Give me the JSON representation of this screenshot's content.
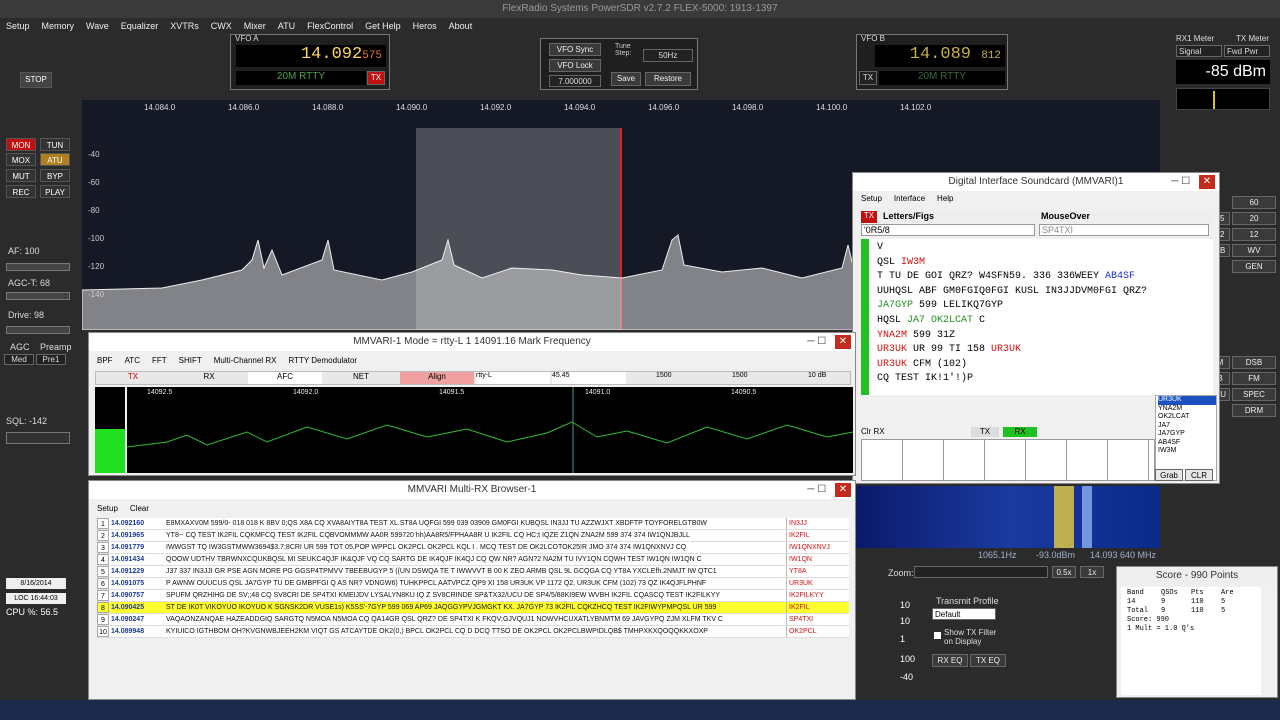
{
  "app": {
    "title": "FlexRadio Systems    PowerSDR    v2.7.2    FLEX-5000: 1913-1397"
  },
  "menu": [
    "Setup",
    "Memory",
    "Wave",
    "Equalizer",
    "XVTRs",
    "CWX",
    "Mixer",
    "ATU",
    "FlexControl",
    "Get Help",
    "Heros",
    "About"
  ],
  "vfoA": {
    "label": "VFO A",
    "freq": "14.092",
    "freq_small": "575",
    "mode": "20M RTTY",
    "tx": "TX"
  },
  "vfoB": {
    "label": "VFO B",
    "freq": "14.089",
    "freq_small": "812",
    "mode": "20M RTTY",
    "tx": "TX"
  },
  "center": {
    "sync": "VFO Sync",
    "lock": "VFO Lock",
    "tune_step_label": "Tune Step:",
    "tune_step": "50Hz",
    "freq": "7.000000",
    "save": "Save",
    "restore": "Restore"
  },
  "meter": {
    "rx1_label": "RX1 Meter",
    "tx_label": "TX Meter",
    "rx_sel": "Signal",
    "tx_sel": "Fwd Pwr",
    "value": "-85 dBm"
  },
  "pan": {
    "freq_labels": [
      "14.084.0",
      "14.086.0",
      "14.088.0",
      "14.090.0",
      "14.092.0",
      "14.094.0",
      "14.096.0",
      "14.098.0",
      "14.100.0",
      "14.102.0"
    ],
    "db_labels": [
      "-40",
      "-60",
      "-80",
      "-100",
      "-120",
      "-140"
    ]
  },
  "left": {
    "stop": "STOP",
    "mon": "MON",
    "tun": "TUN",
    "mox": "MOX",
    "atu": "ATU",
    "mut": "MUT",
    "byp": "BYP",
    "rec": "REC",
    "play": "PLAY",
    "af": "AF:  100",
    "agct": "AGC-T:  68",
    "drive": "Drive:  98",
    "agc": "AGC",
    "preamp": "Preamp",
    "agc_sel": "Med",
    "pre_sel": "Pre1",
    "sql": "SQL: -142",
    "date": "8/16/2014",
    "loc": "LOC 16:44:03",
    "cpu": "CPU %: 56.5"
  },
  "right_btns": [
    "60",
    "20",
    "12",
    "WV",
    "GEN",
    "DSB",
    "FM",
    "SPEC",
    "DRM"
  ],
  "right_btns2": [
    "15",
    "12",
    "SB",
    "M",
    "B",
    "GU"
  ],
  "digi": {
    "title": "Digital Interface Soundcard (MMVARI)1",
    "menu": [
      "Setup",
      "Interface",
      "Help"
    ],
    "tx": "TX",
    "letters": "Letters/Figs",
    "mouseover": "MouseOver",
    "field1": "'0R5/8",
    "field2": "SP4TXI",
    "lines": [
      [
        {
          "t": "V",
          "c": "k"
        }
      ],
      [
        {
          "t": "QSL ",
          "c": "k"
        },
        {
          "t": "IW3M",
          "c": "r"
        }
      ],
      [
        {
          "t": "T TU  DE GOI QRZ? W4SFN59. 336 336WEEY ",
          "c": "k"
        },
        {
          "t": "AB4SF",
          "c": "b"
        }
      ],
      [
        {
          "t": "UUHQSL ABF GM0FGIQ0FGI KUSL IN3JJDVM0FGI QRZ?",
          "c": "k"
        }
      ],
      [
        {
          "t": "JA7GYP",
          "c": "g"
        },
        {
          "t": " 599 LELIKQ7GYP",
          "c": "k"
        }
      ],
      [
        {
          "t": "HQSL ",
          "c": "k"
        },
        {
          "t": "JA7 OK2LCAT",
          "c": "g"
        },
        {
          "t": " C",
          "c": "k"
        }
      ],
      [
        {
          "t": "YNA2M",
          "c": "r"
        },
        {
          "t": " 599 31Z",
          "c": "k"
        }
      ],
      [
        {
          "t": "UR3UK",
          "c": "r"
        },
        {
          "t": " UR 99 TI 158 ",
          "c": "k"
        },
        {
          "t": "UR3UK",
          "c": "r"
        }
      ],
      [
        {
          "t": "UR3UK",
          "c": "r"
        },
        {
          "t": " CFM (102)",
          "c": "k"
        }
      ],
      [
        {
          "t": "CQ TEST IK!1'!)P",
          "c": "k"
        }
      ]
    ],
    "calls": [
      "UR3UK",
      "YNA2M",
      "OK2LCAT",
      "JA7",
      "JA7GYP",
      "AB4SF",
      "IW3M"
    ],
    "clrrx": "Clr RX",
    "txb": "TX",
    "rxb": "RX",
    "grab": "Grab",
    "clr": "CLR"
  },
  "mmvari": {
    "title": "MMVARI-1 Mode = rtty-L 1 14091.16 Mark Frequency",
    "menu": [
      "BPF",
      "ATC",
      "FFT",
      "SHIFT",
      "Multi-Channel RX",
      "RTTY Demodulator"
    ],
    "btns": [
      "TX",
      "RX",
      "AFC",
      "NET",
      "Align"
    ],
    "mode": "rtty-L",
    "shift": "45.45",
    "v1": "1500",
    "v2": "1500",
    "v3": "10 dB",
    "scale": [
      "14092.5",
      "14092.0",
      "14091.5",
      "14091.0",
      "14090.5"
    ]
  },
  "multirx": {
    "title": "MMVARI Multi-RX Browser-1",
    "menu": [
      "Setup",
      "Clear"
    ],
    "rows": [
      {
        "n": "1",
        "f": "14.092160",
        "t": "E8MXAXV0M 599/0- 018 018  K  8BV 0;QS X8A CQ  XVA8AIYT8A TEST  XL.ST8A UQFGI 599 039 03909 GM0FGI KUBQSL IN3JJ TU AZZWJXT XBDFTP TOYFORELGTB0W",
        "c": "IN3JJ"
      },
      {
        "n": "2",
        "f": "14.091965",
        "t": "YT8-- CQ TEST IK2FIL CQKMFCQ TEST IK2FIL CQBVOMMMW AA0R 599720 hh)AA8R5/FPHAA8R U IK2FIL CQ HC;t IQZE Z1QN ZNA2M 599 374 374 IW1QNJBJLL",
        "c": "IK2FIL"
      },
      {
        "n": "3",
        "f": "14.091779",
        "t": "IWWGST TQ  IW3GSTMWW3694$3.7;8CRI UR 599 TOT 05,POP WPPCL OK2PCL OK2PCL  KQL I   .   MCQ TEST DE OK2LCOTOK25!R JMO 374 374 IW1QNXNVJ CQ",
        "c": "IW1QNXNVJ"
      },
      {
        "n": "4",
        "f": "14.091434",
        "t": "QOOW UDTHV TBRWNXCQUKBQSL MI  SEUKC4QJF IK&QJF VQ  CQ  SARTG DE IK4QJF IK4QJ CQ  QW NR? AGN?2  NA2M TU IVY1QN CQWH TEST IW1QN IW1QN C",
        "c": "IW1QN"
      },
      {
        "n": "5",
        "f": "14.091229",
        "t": "J37 337 IN3JJI GR PSE AGN MORE PG GGSP4TPMVV TBEEBUGYP 5 ((UN DSWQA TE T IWWVVT B 00 K ZEO ARMB QSL 9L GCQGA CQ YT8A YXCLEfh.2NMJT IW QTC1",
        "c": "YT8A"
      },
      {
        "n": "6",
        "f": "14.091075",
        "t": "P AWNW OUUCUS  QSL JA7GYP TU DE GMBPFGI Q AS  NR?  VDNGW6) TUHKPPCL AATVPCZ QP9 XI 158 UR3UK  VP 1172 Q2, UR3UK CFM (102) 73  QZ IK4QJFLPHNF",
        "c": "UR3UK"
      },
      {
        "n": "7",
        "f": "14.090757",
        "t": "SPUFM QRZHIHG DE SV;;48 CQ  SV8CRI DE SP4TXI KMEIJDV LYSALYN8KU IQ Z  SV8CRINDE SP&TX32/UCU DE SP4/5/88KI9EW WVBH IK2FIL CQASCQ TEST IK2FILKYY",
        "c": "IK2FILKYY"
      },
      {
        "n": "8",
        "f": "14.090425",
        "t": "ST DE IK0T VIKOYUO IKOYUO   K  SGNSK2DR  VUSE1s) K5SS'-7GYP  599 069 AP69 JAQGGYPVJGMGKT KX. JA7GYP 73 IK2FIL CQKZHCQ TEST IK2FIWYPMPQSL UR 599",
        "c": "IK2FIL",
        "hl": true
      },
      {
        "n": "9",
        "f": "14.090247",
        "t": "VAQAONZANQAE HAZEADDGIQ SARGTQ N5MOA N5MOA CQ  QA14GR QSL   QRZ? DE SP4TXI K FKQV;GJVQUJ1  NOWVHCUXATLYBNMTM 69 JAVGYPQ ZJM XLFM TKV C",
        "c": "SP4TXI"
      },
      {
        "n": "10",
        "f": "14.089948",
        "t": "KYIUICO IGTHBOM  OH?KVGNWBJEEH2KM VIQT GS ATCAYTDE OK2(0,) BPCL OK2PCL CQ     D   DCQ TTSO DE OK2PCL  OK2PCLBWPIDLQB$ TMHPXKXQOQQKKXOXP",
        "c": "OK2PCL"
      }
    ]
  },
  "zoom": {
    "label": "Zoom:",
    "v1": "0.5x",
    "v2": "1x"
  },
  "wf": {
    "hz": "1065.1Hz",
    "db": "-93.0dBm",
    "freq": "14.093 640 MHz"
  },
  "tx_profile": {
    "label": "Transmit Profile",
    "sel": "Default",
    "filter": "Show TX Filter on Display",
    "rxeq": "RX EQ",
    "txeq": "TX EQ"
  },
  "sliders": [
    "10",
    "10",
    "1",
    "100",
    "-40"
  ],
  "score": {
    "title": "Score - 990 Points",
    "header": [
      "Band",
      "QSOs",
      "Pts",
      "Are"
    ],
    "row1": [
      "14",
      "9",
      "110",
      "5"
    ],
    "row2": [
      "Total",
      "9",
      "110",
      "5"
    ],
    "score": "Score: 990",
    "mult": "1 Mult = 1.0 Q's"
  }
}
